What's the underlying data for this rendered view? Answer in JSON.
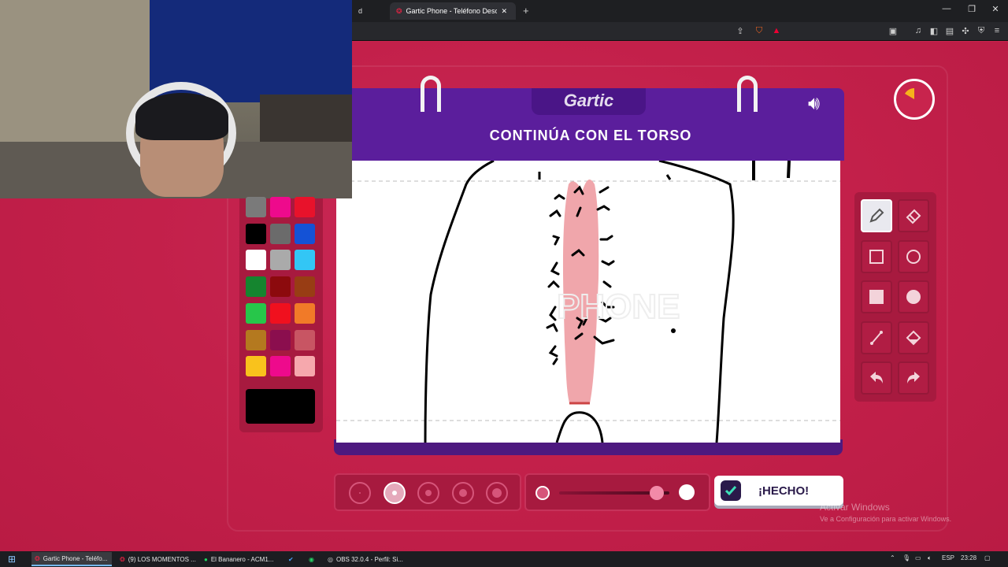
{
  "browser": {
    "tabs": [
      {
        "label": "d",
        "active": false
      },
      {
        "label": "Gartic Phone - Teléfono Descom...",
        "active": true
      }
    ],
    "new_tab": "+",
    "window_controls": {
      "minimize": "—",
      "restore": "❐",
      "close": "✕"
    }
  },
  "game": {
    "logo": "Gartic",
    "instruction": "CONTINÚA CON EL TORSO",
    "done_button": "¡HECHO!",
    "palette": [
      [
        "#7a7a7a",
        "#ee0a8c",
        "#e8122b"
      ],
      [
        "#000000",
        "#6b6b6b",
        "#1452d6"
      ],
      [
        "#ffffff",
        "#aaaaaa",
        "#33c6f5"
      ],
      [
        "#15852f",
        "#8c0a0d",
        "#983d14"
      ],
      [
        "#27c64a",
        "#f0101e",
        "#f17a28"
      ],
      [
        "#b4791f",
        "#8b0e4e",
        "#c85563"
      ],
      [
        "#f9c21c",
        "#ee0a8c",
        "#f6a8ad"
      ]
    ],
    "selected_color": "#000000",
    "tools": [
      "pencil-icon",
      "eraser-icon",
      "square-outline-icon",
      "circle-outline-icon",
      "square-filled-icon",
      "circle-filled-icon",
      "line-icon",
      "fill-bucket-icon",
      "undo-icon",
      "redo-icon"
    ],
    "selected_tool": "pencil-icon",
    "brush_sizes": 5,
    "selected_brush": 1,
    "opacity_level": 0.85
  },
  "watermark": {
    "line1": "Activar Windows",
    "line2": "Ve a Configuración para activar Windows."
  },
  "taskbar": {
    "apps": [
      {
        "label": "Gartic Phone - Teléfo...",
        "active": true
      },
      {
        "label": "(9) LOS MOMENTOS ...",
        "active": false
      },
      {
        "label": "El Bananero - ACM1...",
        "active": false
      },
      {
        "label": "",
        "active": false
      },
      {
        "label": "",
        "active": false
      },
      {
        "label": "OBS 32.0.4 - Perfil: Si...",
        "active": false
      }
    ],
    "lang": "ESP",
    "time": "23:28"
  }
}
